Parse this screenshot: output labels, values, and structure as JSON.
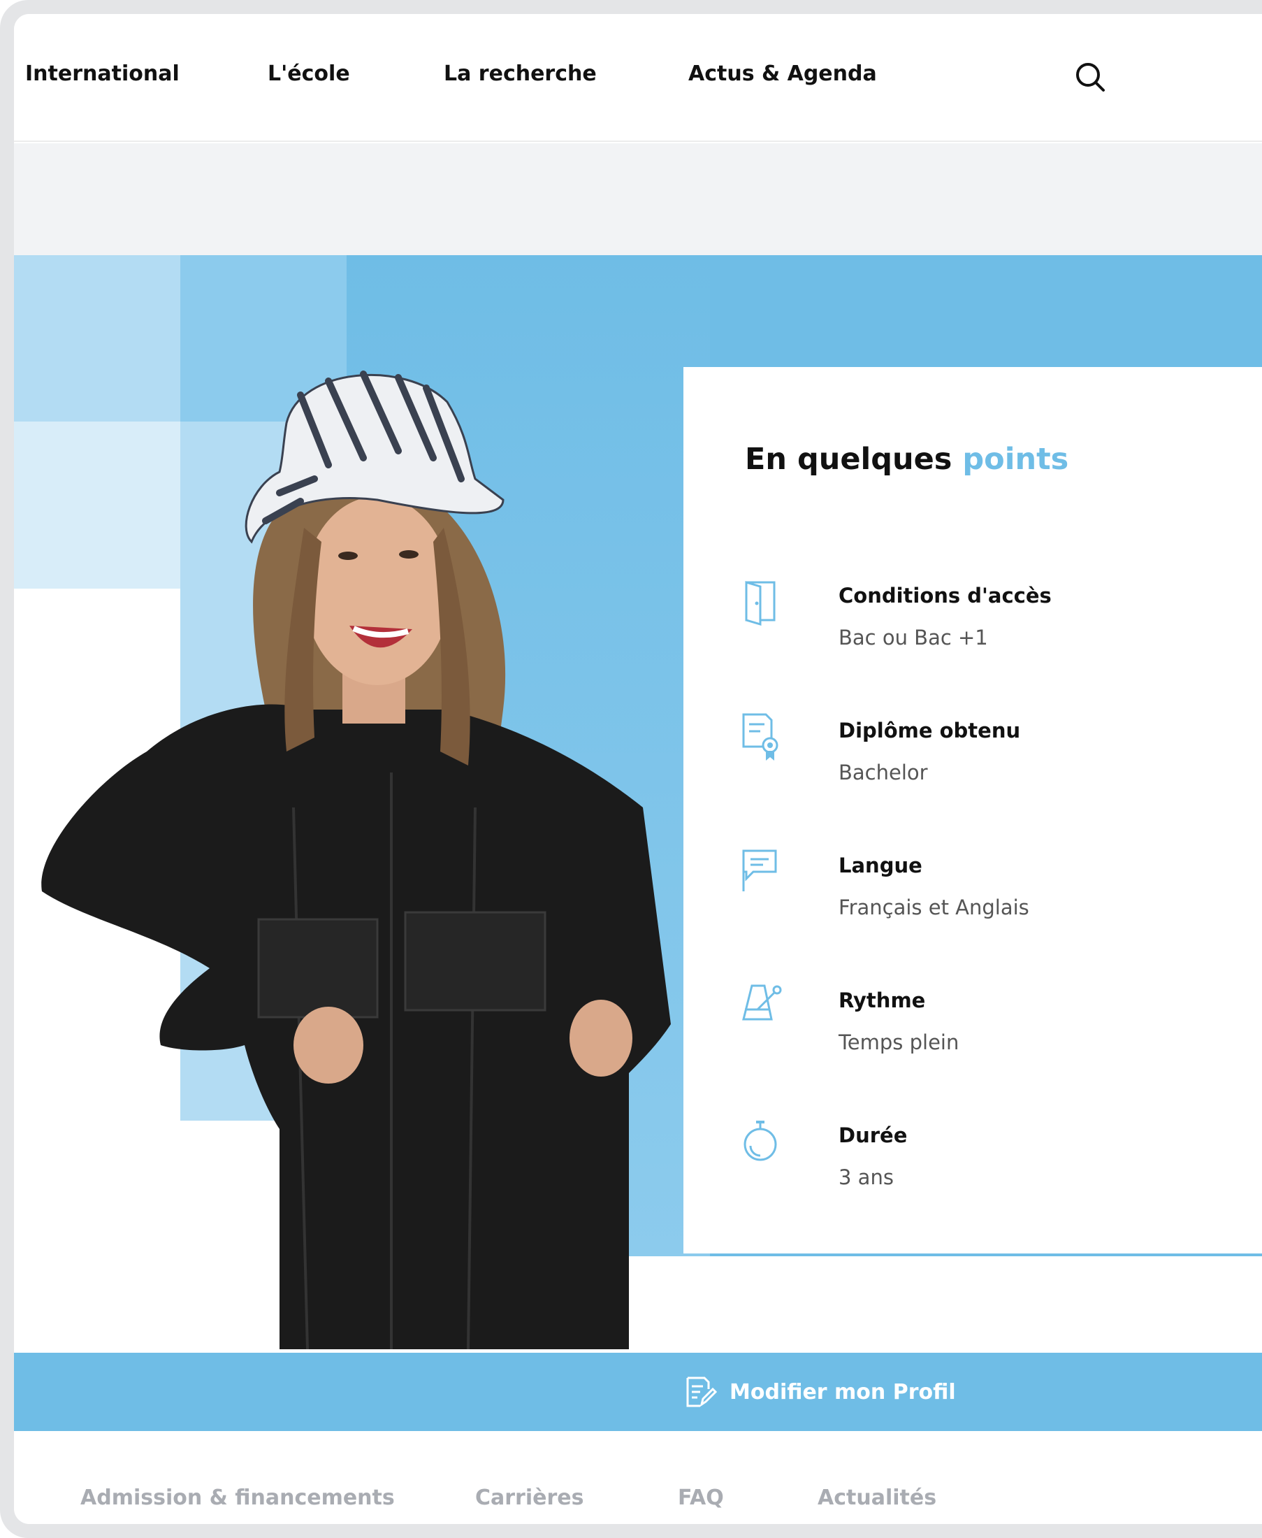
{
  "nav": {
    "items": [
      {
        "label": "International"
      },
      {
        "label": "L'école"
      },
      {
        "label": "La recherche"
      },
      {
        "label": "Actus & Agenda"
      }
    ],
    "search_icon": "search-icon"
  },
  "hero": {
    "card": {
      "title_prefix": "En quelques",
      "title_accent": "points",
      "items": [
        {
          "label": "Conditions d'accès",
          "value": "Bac ou Bac +1",
          "icon": "door-icon"
        },
        {
          "label": "Diplôme obtenu",
          "value": "Bachelor",
          "icon": "diploma-certificate-icon"
        },
        {
          "label": "Langue",
          "value": "Français et Anglais",
          "icon": "speech-flag-icon"
        },
        {
          "label": "Rythme",
          "value": "Temps plein",
          "icon": "metronome-icon"
        },
        {
          "label": "Durée",
          "value": "3 ans",
          "icon": "stopwatch-icon"
        }
      ]
    }
  },
  "profile": {
    "button_label": "Modifier mon Profil",
    "icon": "edit-document-icon"
  },
  "bottom_tabs": {
    "items": [
      {
        "label": "Admission & financements"
      },
      {
        "label": "Carrières"
      },
      {
        "label": "FAQ"
      },
      {
        "label": "Actualités"
      }
    ]
  },
  "colors": {
    "accent": "#6fbde6",
    "text_dark": "#111111",
    "text_muted": "#555555",
    "tab_inactive": "#a9acb2"
  }
}
